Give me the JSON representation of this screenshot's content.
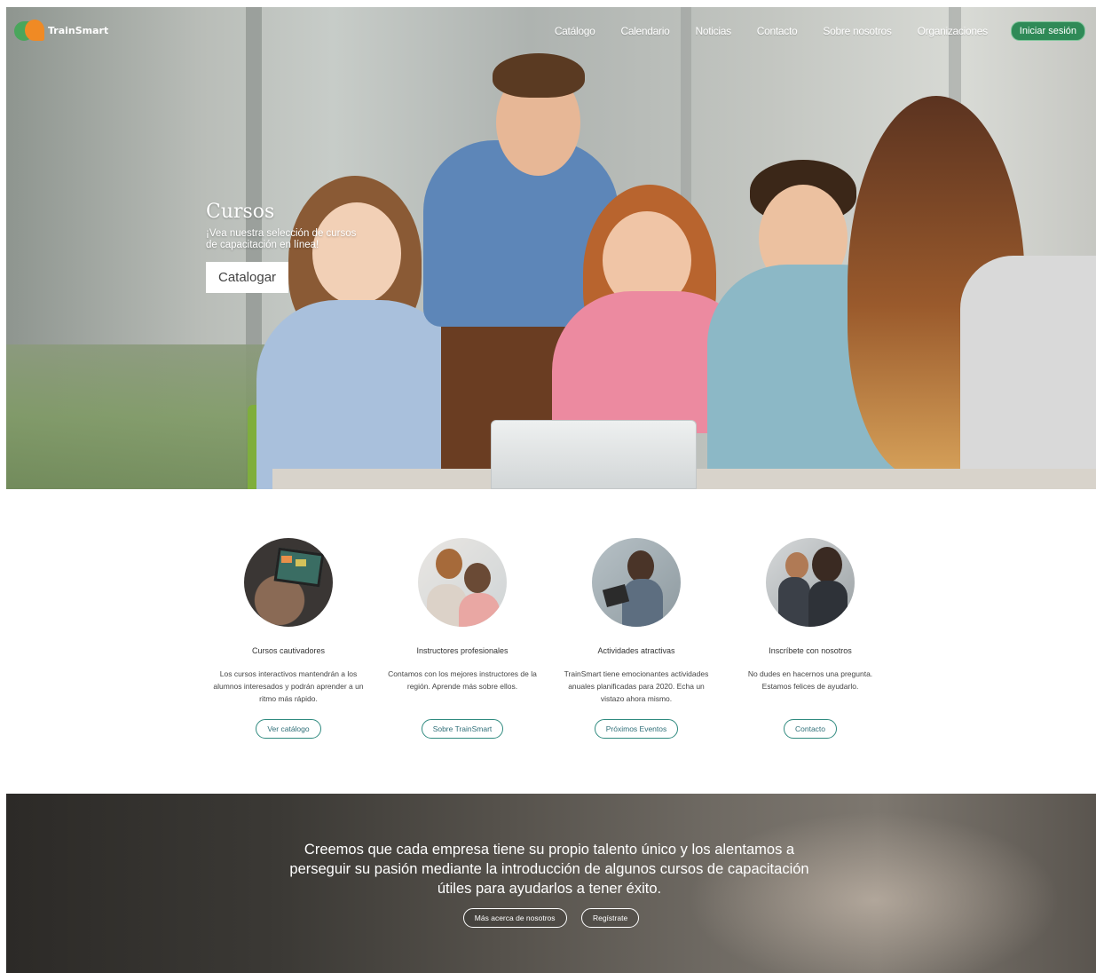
{
  "nav": {
    "logo_text": "TrainSmart",
    "links": [
      "Catálogo",
      "Calendario",
      "Noticias",
      "Contacto",
      "Sobre nosotros",
      "Organizaciones"
    ],
    "login_label": "Iniciar sesión"
  },
  "hero": {
    "title": "Cursos",
    "subtitle": "¡Vea nuestra selección de cursos de capacitación en línea!",
    "button_label": "Catalogar"
  },
  "features": [
    {
      "title": "Cursos cautivadores",
      "description": "Los cursos interactivos mantendrán a los alumnos interesados y podrán aprender a un ritmo más rápido.",
      "button_label": "Ver catálogo",
      "image_icon": "laptop-icon"
    },
    {
      "title": "Instructores profesionales",
      "description": "Contamos con los mejores instructores de la región. Aprende más sobre ellos.",
      "button_label": "Sobre TrainSmart",
      "image_icon": "instructors-icon"
    },
    {
      "title": "Actividades atractivas",
      "description": "TrainSmart tiene emocionantes actividades anuales planificadas para 2020. Echa un vistazo ahora mismo.",
      "button_label": "Próximos Eventos",
      "image_icon": "tablet-headphones-icon"
    },
    {
      "title": "Inscríbete con nosotros",
      "description": "No dudes en hacernos una pregunta. Estamos felices de ayudarlo.",
      "button_label": "Contacto",
      "image_icon": "team-icon"
    }
  ],
  "band": {
    "text": "Creemos que cada empresa tiene su propio talento único y los alentamos a perseguir su pasión mediante la introducción de algunos cursos de capacitación útiles para ayudarlos a tener éxito.",
    "buttons": [
      "Más acerca de nosotros",
      "Regístrate"
    ]
  },
  "colors": {
    "accent_green": "#2f8a57",
    "button_outline": "#2f8a7f",
    "logo_green": "#4aa65c",
    "logo_orange": "#f08a24"
  }
}
